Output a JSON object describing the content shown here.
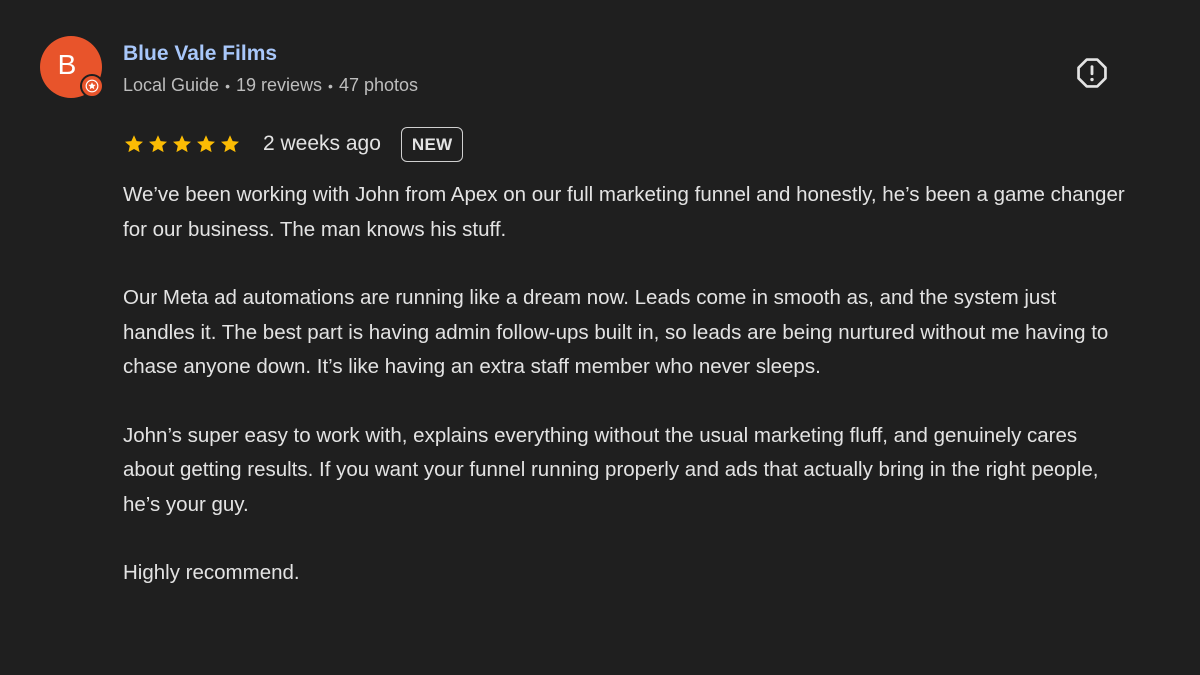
{
  "review": {
    "author": {
      "avatar_letter": "B",
      "avatar_color": "#e8542b",
      "name": "Blue Vale Films",
      "guide_label": "Local Guide",
      "reviews_count": "19 reviews",
      "photos_count": "47 photos",
      "badge_icon": "local-guide-star-icon"
    },
    "report_icon": "report-flag-icon",
    "rating": {
      "stars": 5,
      "star_color": "#fbbc04",
      "time_ago": "2 weeks ago",
      "new_badge": "NEW"
    },
    "paragraphs": [
      "We’ve been working with John from Apex on our full marketing funnel and honestly, he’s been a game changer for our business. The man knows his stuff.",
      "Our Meta ad automations are running like a dream now. Leads come in smooth as, and the system just handles it. The best part is having admin follow-ups built in, so leads are being nurtured without me having to chase anyone down. It’s like having an extra staff member who never sleeps.",
      "John’s super easy to work with, explains everything without the usual marketing fluff, and genuinely cares about getting results. If you want your funnel running properly and ads that actually bring in the right people, he’s your guy.",
      "Highly recommend."
    ]
  }
}
